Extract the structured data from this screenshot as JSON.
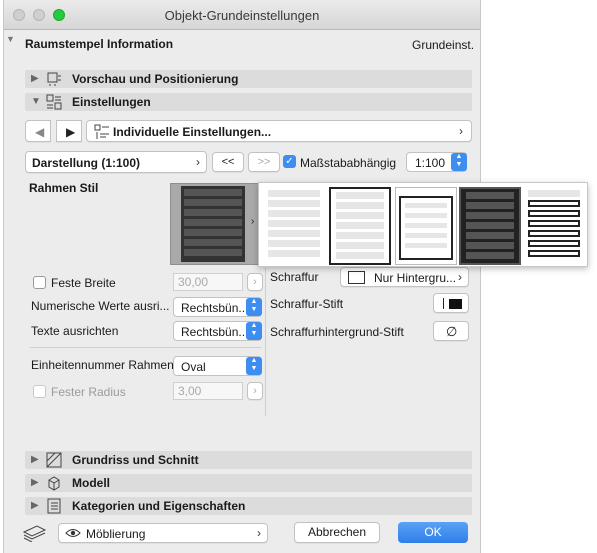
{
  "window": {
    "title": "Objekt-Grundeinstellungen"
  },
  "header": {
    "left": "Raumstempel Information",
    "right": "Grundeinst."
  },
  "sections": {
    "vorschau": "Vorschau und Positionierung",
    "einstellungen": "Einstellungen",
    "grundriss": "Grundriss und Schnitt",
    "modell": "Modell",
    "kategorien": "Kategorien und Eigenschaften"
  },
  "nav": {
    "dropdown": "Individuelle Einstellungen..."
  },
  "darstellung": {
    "label": "Darstellung (1:100)",
    "back": "<<",
    "fwd": ">>",
    "scale_check_label": "Maßstababhängig",
    "scale_checked": true,
    "scale_value": "1:100"
  },
  "left": {
    "rahmen_stil": "Rahmen Stil",
    "feste_breite": "Feste Breite",
    "feste_breite_value": "30,00",
    "numerisch": "Numerische Werte ausri...",
    "numerisch_value": "Rechtsbün...",
    "texte": "Texte ausrichten",
    "texte_value": "Rechtsbün...",
    "einheiten": "Einheitennummer Rahmen",
    "einheiten_value": "Oval",
    "fester_radius": "Fester Radius",
    "fester_radius_value": "3,00"
  },
  "right": {
    "schraffur": "Schraffur",
    "schraffur_value": "Nur Hintergru...",
    "stift": "Schraffur-Stift",
    "hg_stift": "Schraffurhintergrund-Stift"
  },
  "footer": {
    "favorite": "Möblierung",
    "cancel": "Abbrechen",
    "ok": "OK"
  },
  "colors": {
    "accent": "#3d8ef0",
    "dark_row": "#4a4a4a"
  }
}
